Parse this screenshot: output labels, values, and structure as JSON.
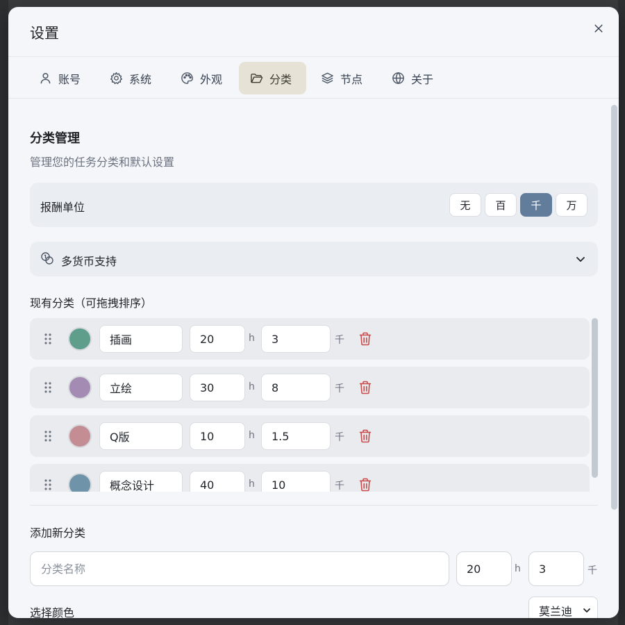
{
  "dialog": {
    "title": "设置",
    "close_icon": "close-icon"
  },
  "tabs": [
    {
      "label": "账号",
      "icon": "user-icon",
      "active": false
    },
    {
      "label": "系统",
      "icon": "gear-icon",
      "active": false
    },
    {
      "label": "外观",
      "icon": "palette-icon",
      "active": false
    },
    {
      "label": "分类",
      "icon": "folder-icon",
      "active": true
    },
    {
      "label": "节点",
      "icon": "layers-icon",
      "active": false
    },
    {
      "label": "关于",
      "icon": "globe-icon",
      "active": false
    }
  ],
  "category_management": {
    "title": "分类管理",
    "description": "管理您的任务分类和默认设置",
    "reward_unit": {
      "label": "报酬单位",
      "options": [
        "无",
        "百",
        "千",
        "万"
      ],
      "selected": "千"
    },
    "multi_currency": {
      "label": "多货币支持",
      "expanded": false
    },
    "list_title": "现有分类（可拖拽排序）",
    "hours_unit": "h",
    "price_unit": "千",
    "categories": [
      {
        "name": "插画",
        "hours": "20",
        "price": "3",
        "color": "#5f9e8b"
      },
      {
        "name": "立绘",
        "hours": "30",
        "price": "8",
        "color": "#a38bb3"
      },
      {
        "name": "Q版",
        "hours": "10",
        "price": "1.5",
        "color": "#c48d93"
      },
      {
        "name": "概念设计",
        "hours": "40",
        "price": "10",
        "color": "#6f93a9"
      }
    ]
  },
  "add_category": {
    "title": "添加新分类",
    "name_placeholder": "分类名称",
    "hours": "20",
    "hours_unit": "h",
    "price": "3",
    "price_unit": "千",
    "color_title": "选择颜色",
    "palette": "莫兰迪"
  },
  "colors": {
    "accent": "#627d9c",
    "active_tab_bg": "#e6e3d6",
    "delete": "#c94a4a"
  }
}
